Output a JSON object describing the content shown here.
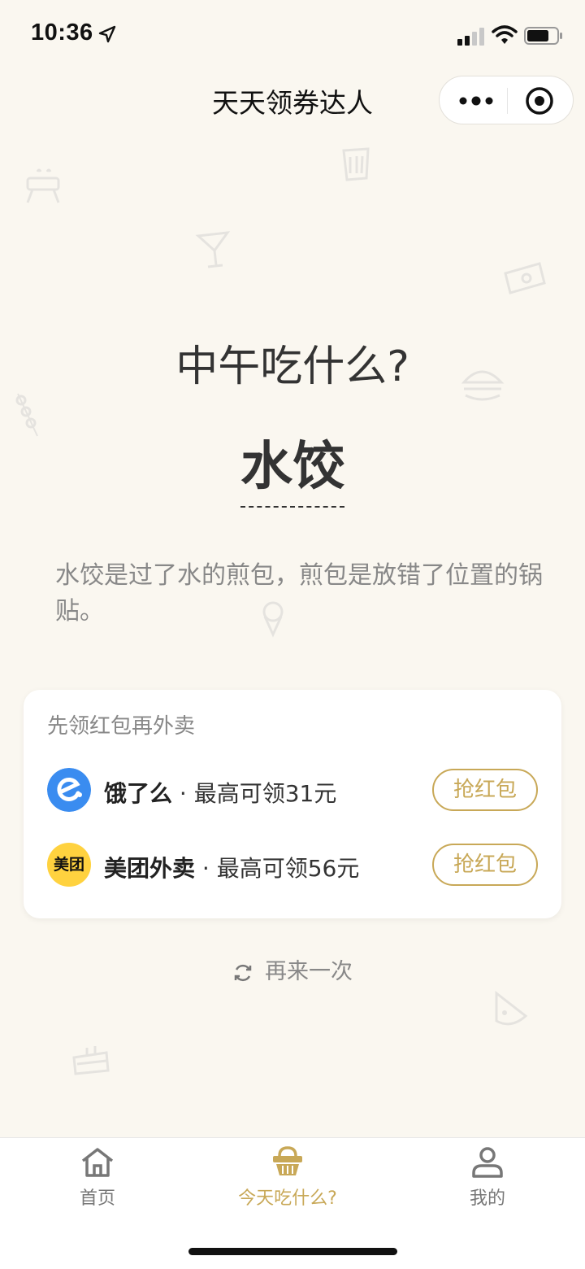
{
  "status_bar": {
    "time": "10:36"
  },
  "nav": {
    "title": "天天领券达人"
  },
  "main": {
    "question": "中午吃什么?",
    "dish": "水饺",
    "description": "水饺是过了水的煎包，煎包是放错了位置的锅贴。"
  },
  "coupon_card": {
    "title": "先领红包再外卖",
    "items": [
      {
        "name": "饿了么",
        "sub": " · 最高可领31元",
        "button": "抢红包",
        "logo_icon": "eleme-logo"
      },
      {
        "name": "美团外卖",
        "sub": " · 最高可领56元",
        "button": "抢红包",
        "logo_icon": "meituan-logo",
        "logo_text": "美团"
      }
    ]
  },
  "retry": {
    "label": "再来一次"
  },
  "tabbar": {
    "items": [
      {
        "label": "首页",
        "icon": "home-icon"
      },
      {
        "label": "今天吃什么?",
        "icon": "basket-icon",
        "active": true
      },
      {
        "label": "我的",
        "icon": "user-icon"
      }
    ]
  },
  "colors": {
    "accent": "#c8a857",
    "background": "#faf7f0",
    "eleme_blue": "#3a8cf0",
    "meituan_yellow": "#ffd23f"
  }
}
